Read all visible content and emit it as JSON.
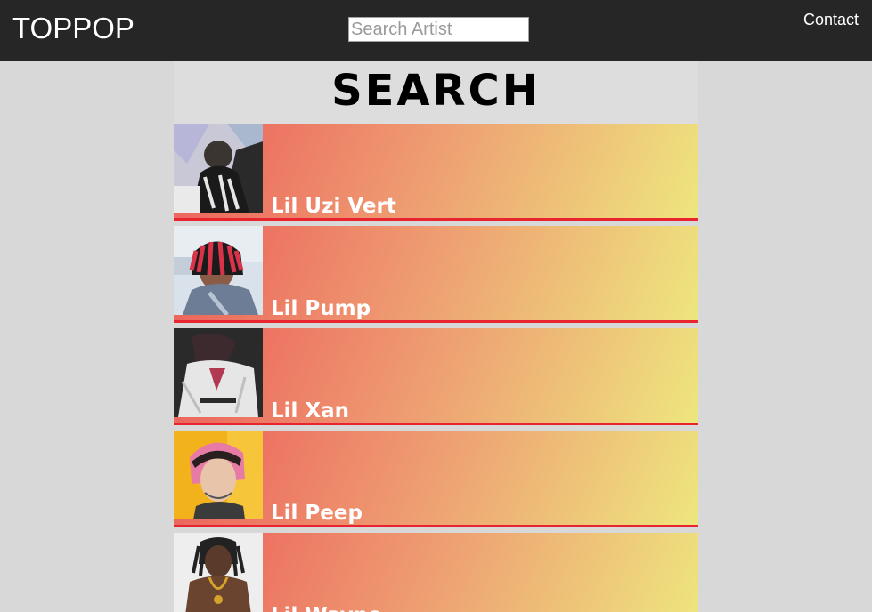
{
  "header": {
    "brand": "TOPPOP",
    "search_placeholder": "Search Artist",
    "contact_label": "Contact"
  },
  "main": {
    "title": "SEARCH",
    "artists": [
      {
        "name": "Lil Uzi Vert",
        "photo": "artist-photo"
      },
      {
        "name": "Lil Pump",
        "photo": "artist-photo"
      },
      {
        "name": "Lil Xan",
        "photo": "artist-photo"
      },
      {
        "name": "Lil Peep",
        "photo": "artist-photo"
      },
      {
        "name": "Lil Wayne",
        "photo": "artist-photo"
      }
    ]
  },
  "colors": {
    "topbar": "#262626",
    "page_background": "#d8d8d8",
    "gradient_start": "#ec5e5a",
    "gradient_end": "#eee67e",
    "row_border": "#e8242f"
  }
}
